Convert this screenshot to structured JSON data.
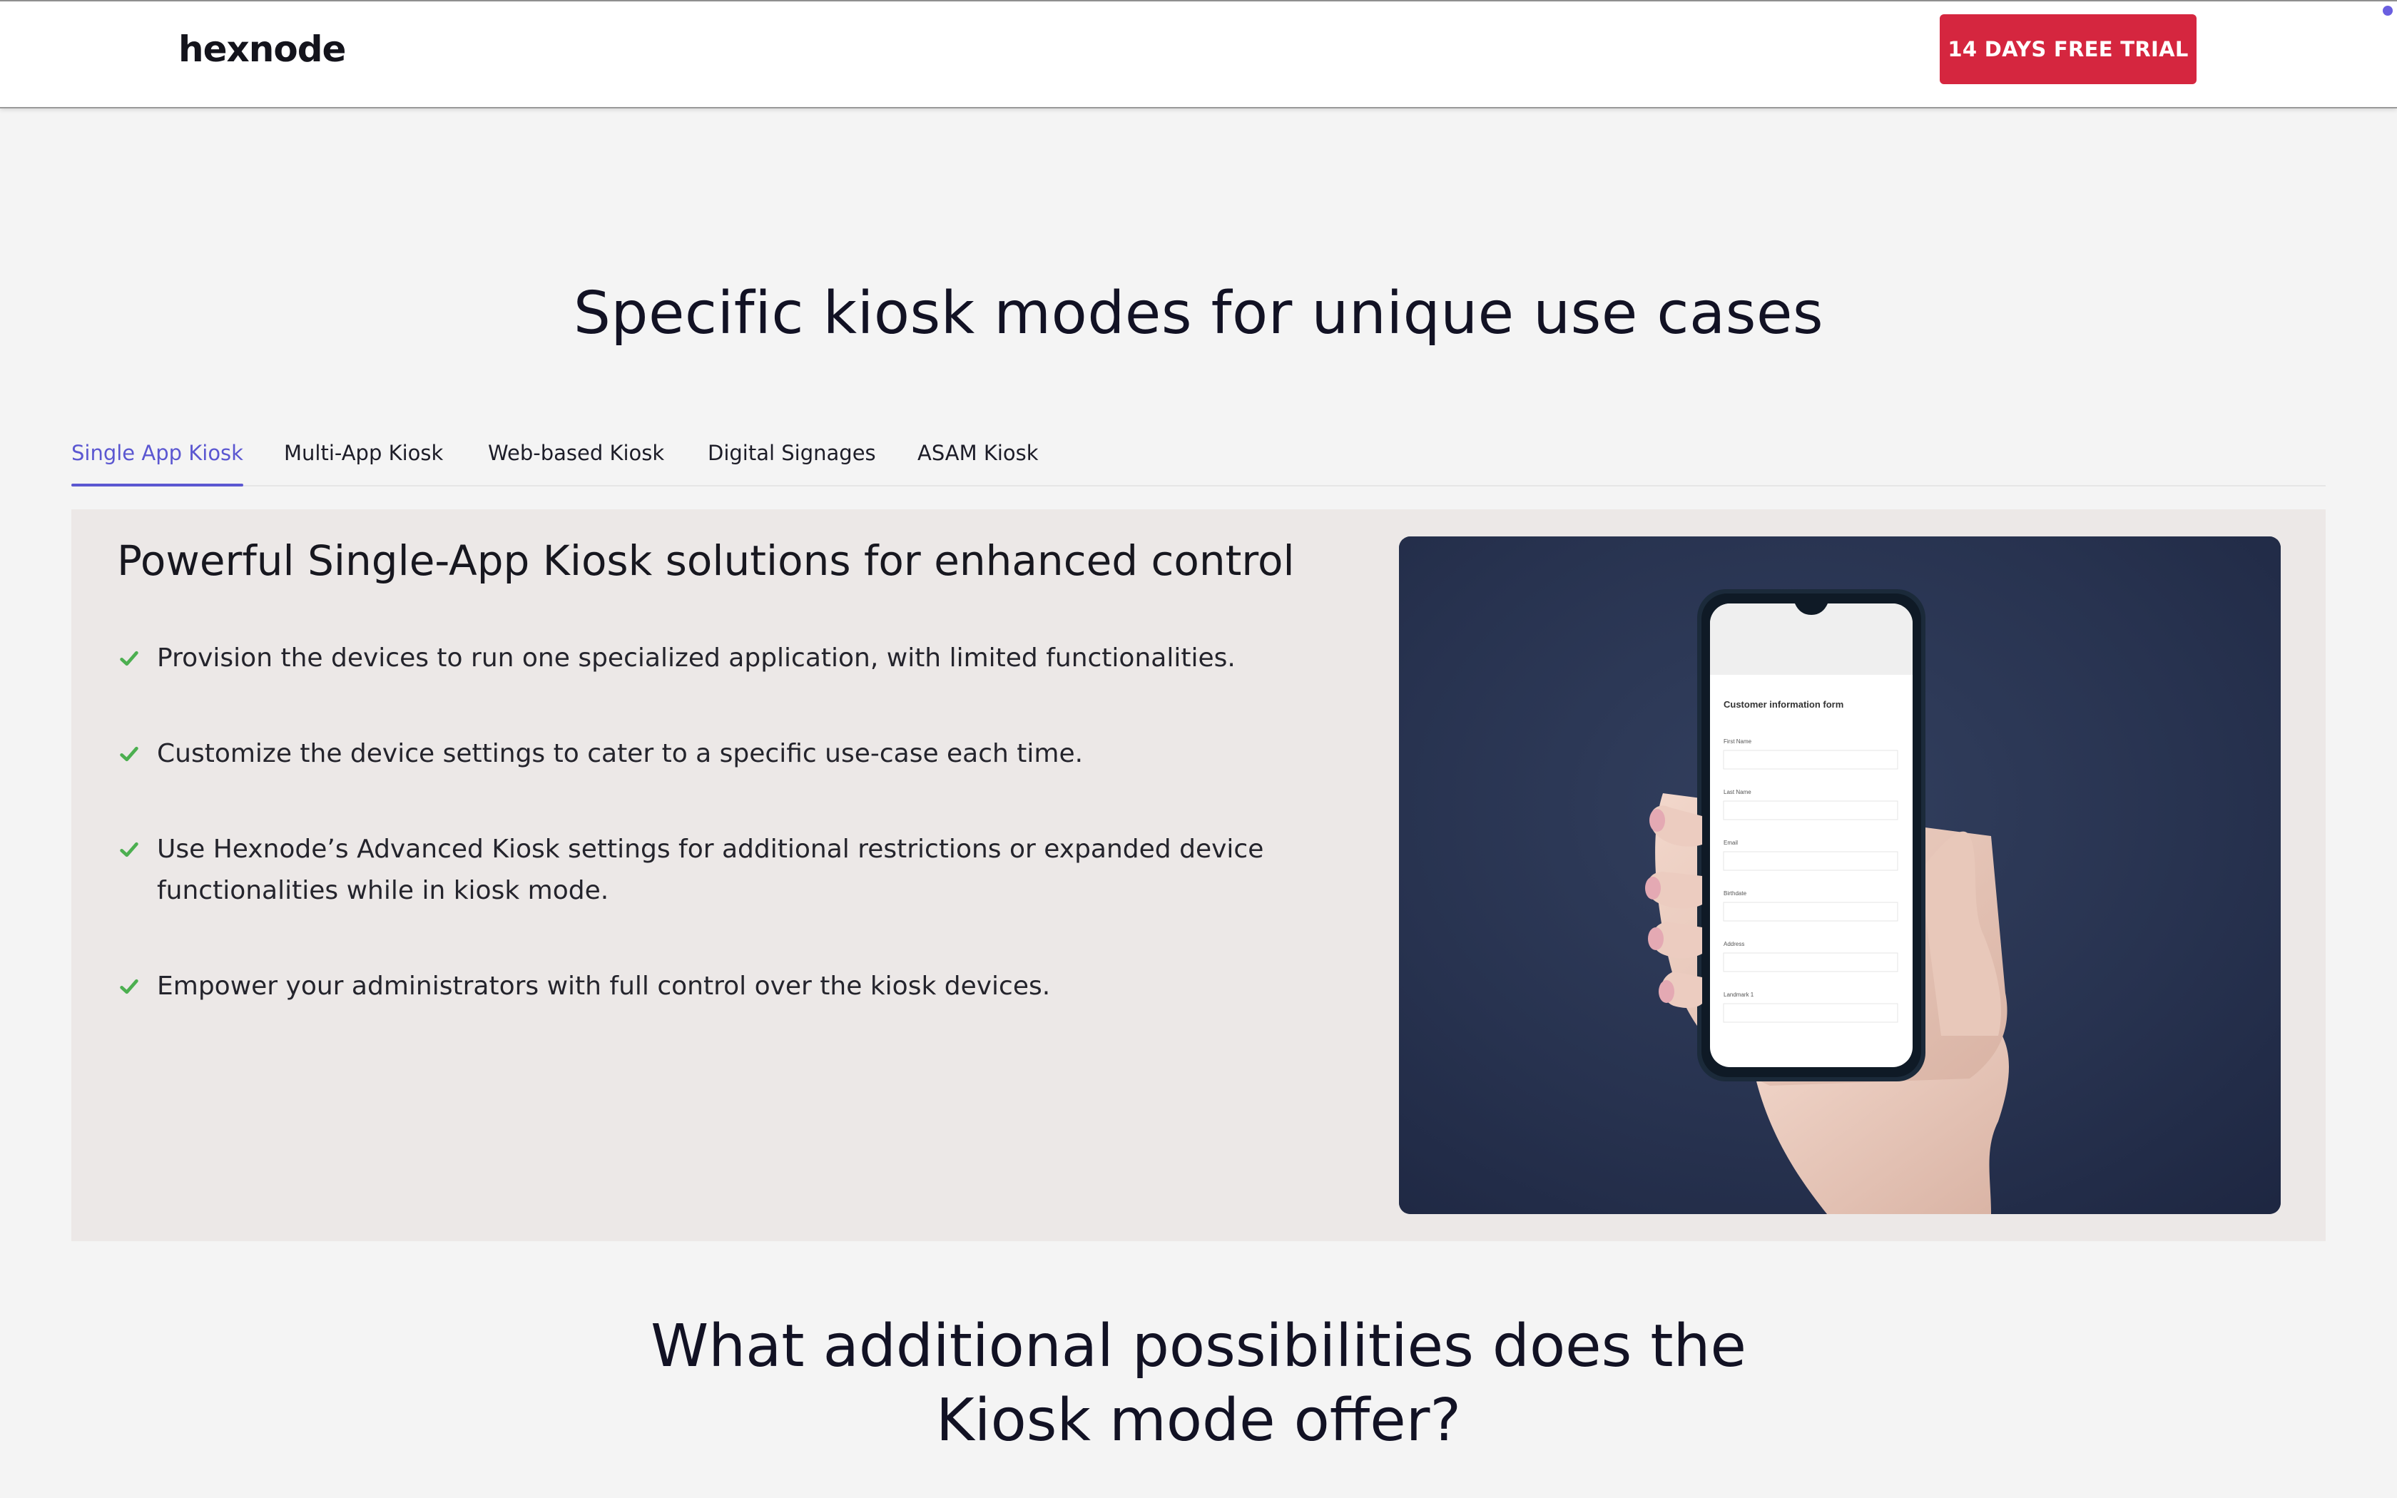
{
  "header": {
    "logo_text": "hexnode",
    "trial_button": "14 DAYS FREE TRIAL"
  },
  "section": {
    "title": "Specific kiosk modes for unique use cases"
  },
  "tabs": [
    {
      "label": "Single App Kiosk",
      "active": true
    },
    {
      "label": "Multi-App Kiosk",
      "active": false
    },
    {
      "label": "Web-based Kiosk",
      "active": false
    },
    {
      "label": "Digital Signages",
      "active": false
    },
    {
      "label": "ASAM Kiosk",
      "active": false
    }
  ],
  "panel": {
    "heading": "Powerful Single-App Kiosk solutions for enhanced control",
    "features": [
      "Provision the devices to run one specialized application, with limited functionalities.",
      "Customize the device settings to cater to a specific use-case each time.",
      "Use Hexnode’s Advanced Kiosk settings for additional restrictions or expanded device functionalities while in kiosk mode.",
      "Empower your administrators with full control over the kiosk devices."
    ],
    "image": {
      "form_title": "Customer information form",
      "fields": [
        "First Name",
        "Last Name",
        "Email",
        "Birthdate",
        "Address",
        "Landmark 1"
      ]
    }
  },
  "bottom": {
    "title": "What additional possibilities does the\nKiosk mode offer?"
  },
  "colors": {
    "accent": "#5b57d1",
    "trial": "#d5263f",
    "check": "#4caf50",
    "panel_bg": "#ece8e7"
  }
}
